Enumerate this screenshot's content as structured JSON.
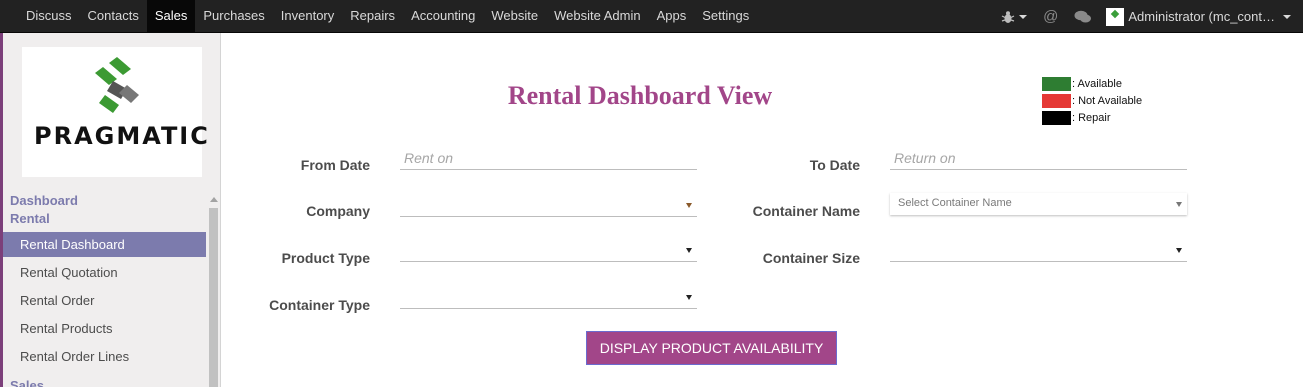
{
  "topbar": {
    "menu": [
      "Discuss",
      "Contacts",
      "Sales",
      "Purchases",
      "Inventory",
      "Repairs",
      "Accounting",
      "Website",
      "Website Admin",
      "Apps",
      "Settings"
    ],
    "active": "Sales",
    "user": "Administrator (mc_cont…"
  },
  "sidebar": {
    "logo_text": "PRAGMATIC",
    "section_dashboard": "Dashboard",
    "section_rental": "Rental",
    "items": [
      "Rental Dashboard",
      "Rental Quotation",
      "Rental Order",
      "Rental Products",
      "Rental Order Lines"
    ],
    "active_item": "Rental Dashboard",
    "section_sales": "Sales"
  },
  "main": {
    "title": "Rental Dashboard View",
    "legend": [
      {
        "label": ": Available",
        "color": "#2e7d32"
      },
      {
        "label": ": Not Available",
        "color": "#e53935"
      },
      {
        "label": ": Repair",
        "color": "#000000"
      }
    ],
    "from_date_label": "From Date",
    "from_date_placeholder": "Rent on",
    "to_date_label": "To Date",
    "to_date_placeholder": "Return on",
    "company_label": "Company",
    "container_name_label": "Container Name",
    "container_name_placeholder": "Select Container Name",
    "product_type_label": "Product Type",
    "container_size_label": "Container Size",
    "container_type_label": "Container Type",
    "display_button": "DISPLAY PRODUCT AVAILABILITY"
  },
  "colors": {
    "navbar": "#222222",
    "accent": "#a24689",
    "sidebar_active": "#7c7bad"
  }
}
